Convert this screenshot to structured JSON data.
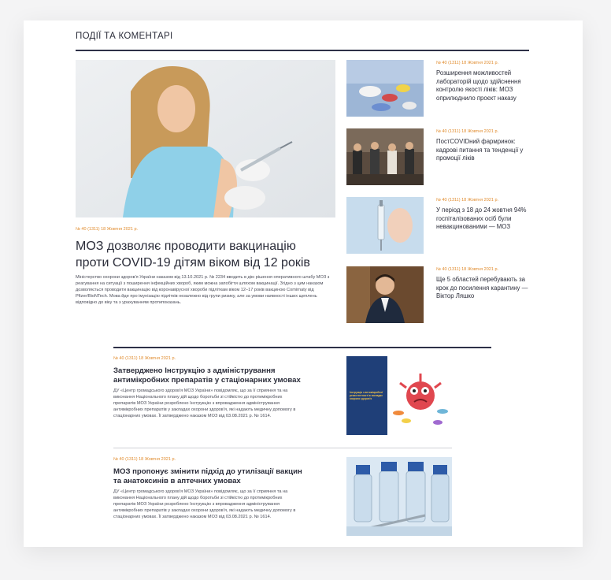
{
  "section": {
    "title": "ПОДІЇ ТА КОМЕНТАРІ"
  },
  "featured": {
    "meta": "№ 40 (1311) 18 Жовтня 2021 р.",
    "title": "МОЗ дозволяє проводити вакцинацію проти COVID-19 дітям віком від 12 років",
    "text": "Міністерство охорони здоров'я України наказом від 13.10.2021 р. № 2234 вводить в дію рішення оперативного штабу МОЗ з реагування на ситуації з поширення інфекційних хвороб, яким можна запобігти шляхом вакцинації. Згідно з цим наказом дозволяється проводити вакцинацію від коронавірусної хвороби підліткам віком 12–17 років вакциною Comirnaty від Pfizer/BioNTech. Мова йде про імунізацію підлітків незалежно від групи ризику, але за умови наявності інших щеплень відповідно до віку та з урахуванням протипоказань."
  },
  "side": [
    {
      "meta": "№ 40 (1311) 18 Жовтня 2021 р.",
      "title": "Розширення можливостей лабораторій щодо здійснення контролю якості ліків: МОЗ оприлюднило проєкт наказу"
    },
    {
      "meta": "№ 40 (1311) 18 Жовтня 2021 р.",
      "title": "ПостCOVIDний фармринок: кадрові питання та тенденції у промоції ліків"
    },
    {
      "meta": "№ 40 (1311) 18 Жовтня 2021 р.",
      "title": "У період з 18 до 24 жовтня 94% госпіталізованих осіб були невакцинованими — МОЗ"
    },
    {
      "meta": "№ 40 (1311) 18 Жовтня 2021 р.",
      "title": "Ще 5 областей перебувають за крок до посилення карантину — Віктор Ляшко"
    }
  ],
  "lower": [
    {
      "meta": "№ 40 (1311) 18 Жовтня 2021 р.",
      "title": "Затверджено Інструкцію з  адміністрування антимікробних препаратів у стаціонарних умовах",
      "text": "ДУ «Центр громадського здоров'я МОЗ України» повідомляє, що за її сприяння та на виконання Національного плану дій щодо боротьби зі стійкістю до протимікробних препаратів МОЗ України розроблено Інструкцію з впровадження адміністрування антимікробних препаратів у закладах охорони здоров'я, які надають медичну допомогу в стаціонарних умовах. Її затверджено наказом МОЗ від 03.08.2021 р. № 1614.",
      "book_text": "Інструкція з антимікробної резистентності в закладах охорони здоров'я"
    },
    {
      "meta": "№ 40 (1311) 18 Жовтня 2021 р.",
      "title": "МОЗ пропонує змінити підхід до утилізації вакцин та анатоксинів в аптечних умовах",
      "text": "ДУ «Центр громадського здоров'я МОЗ України» повідомляє, що за її сприяння та на виконання Національного плану дій щодо боротьби зі стійкістю до протимікробних препаратів МОЗ України розроблено Інструкцію з впровадження адміністрування антимікробних препаратів у закладах охорони здоров'я, які надають медичну допомогу в стаціонарних умовах. Її затверджено наказом МОЗ від 03.08.2021 р. № 1614."
    }
  ],
  "colors": {
    "accent": "#e08a2b",
    "rule": "#2e3148",
    "text": "#2b2d3a"
  }
}
